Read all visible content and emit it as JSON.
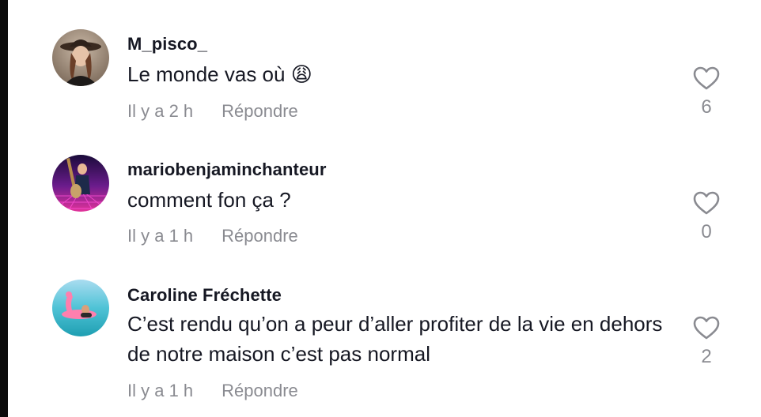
{
  "comments": [
    {
      "username": "M_pisco_",
      "text": "Le monde vas où 😩",
      "time": "Il y a 2 h",
      "reply_label": "Répondre",
      "likes": "6"
    },
    {
      "username": "mariobenjaminchanteur",
      "text": "comment fon ça ?",
      "time": "Il y a 1 h",
      "reply_label": "Répondre",
      "likes": "0"
    },
    {
      "username": "Caroline Fréchette",
      "text": "C’est rendu qu’on a peur d’aller profiter de la vie en dehors de notre maison c’est pas normal",
      "time": "Il y a 1 h",
      "reply_label": "Répondre",
      "likes": "2"
    }
  ],
  "icons": {
    "like": "heart-outline-icon"
  },
  "colors": {
    "text_primary": "#161823",
    "text_secondary": "#8a8b91",
    "background": "#ffffff"
  }
}
